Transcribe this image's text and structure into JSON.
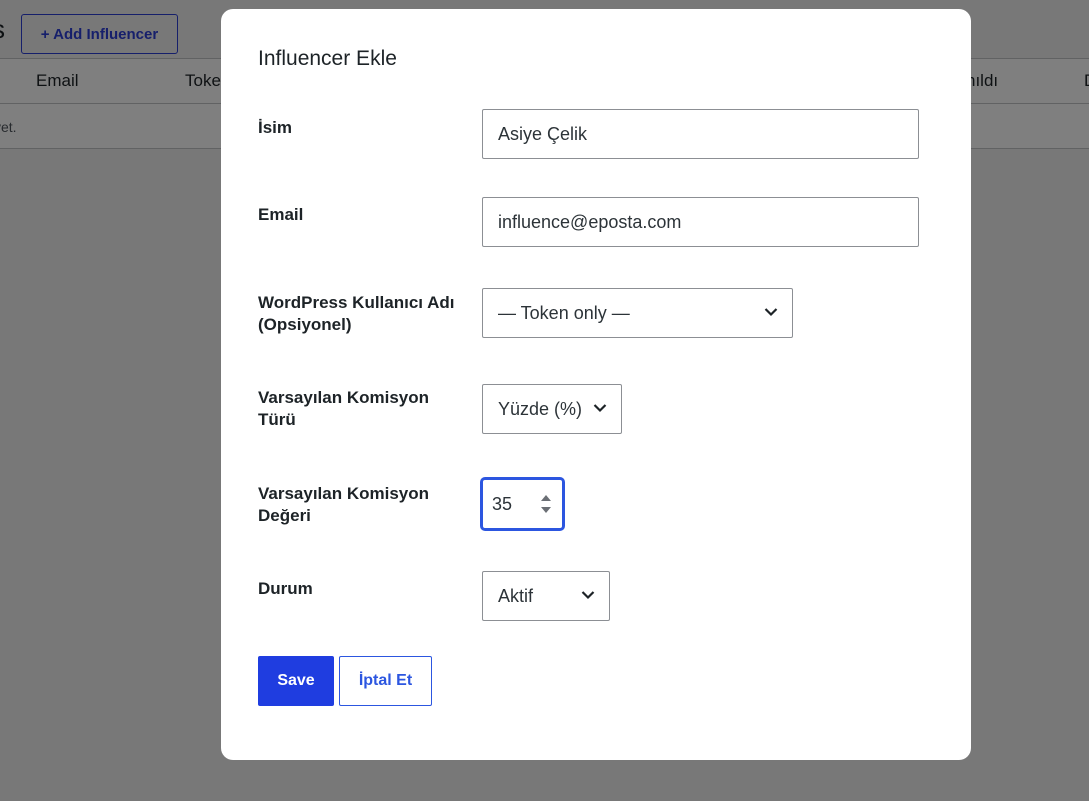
{
  "background": {
    "title_fragment": "s",
    "add_button": "+ Add Influencer",
    "columns": [
      "Email",
      "Toke",
      "nıldı",
      "D"
    ],
    "empty_row_text": "yet."
  },
  "modal": {
    "title": "Influencer Ekle",
    "fields": {
      "name": {
        "label": "İsim",
        "value": "Asiye Çelik"
      },
      "email": {
        "label": "Email",
        "value": "influence@eposta.com"
      },
      "wp_user": {
        "label": "WordPress Kullanıcı Adı (Opsiyonel)",
        "selected": "— Token only —"
      },
      "commission_type": {
        "label": "Varsayılan Komisyon Türü",
        "selected": "Yüzde (%)"
      },
      "commission_value": {
        "label": "Varsayılan Komisyon Değeri",
        "value": "35"
      },
      "status": {
        "label": "Durum",
        "selected": "Aktif"
      }
    },
    "buttons": {
      "save": "Save",
      "cancel": "İptal Et"
    }
  },
  "colors": {
    "primary": "#1f3de0",
    "focus": "#2c56e0",
    "overlay": "rgba(0,0,0,0.5)"
  }
}
